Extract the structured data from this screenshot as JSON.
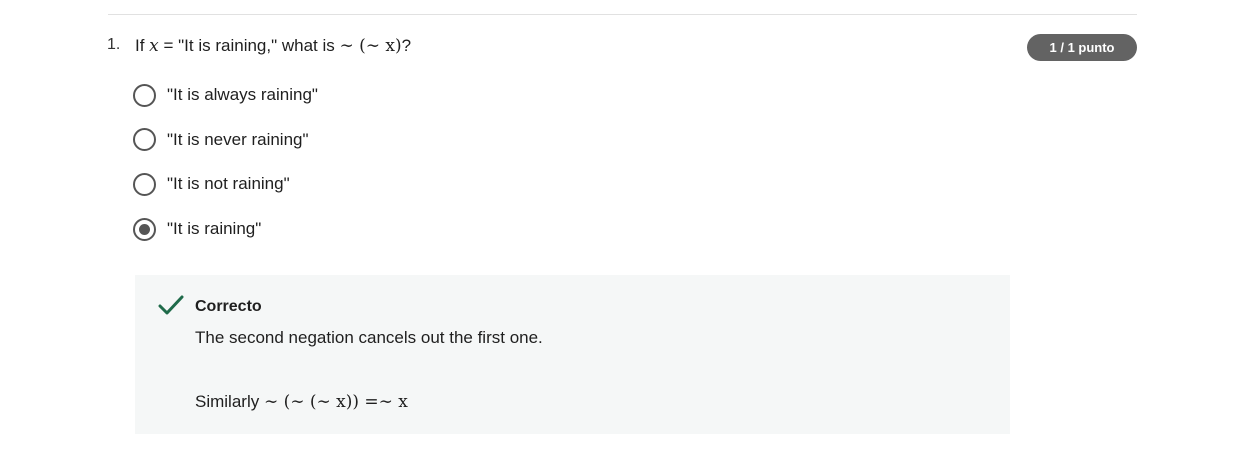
{
  "question": {
    "number": "1.",
    "text_prefix": "If ",
    "var_x": "x",
    "text_mid": " = \"It is raining,\" what is ",
    "math_expr": "∼ (∼ x)",
    "text_suffix": "?",
    "score": "1 / 1 punto"
  },
  "options": [
    {
      "label": "\"It is always raining\"",
      "selected": false
    },
    {
      "label": "\"It is never raining\"",
      "selected": false
    },
    {
      "label": "\"It is not raining\"",
      "selected": false
    },
    {
      "label": "\"It is raining\"",
      "selected": true
    }
  ],
  "feedback": {
    "icon": "checkmark-icon",
    "status": "Correcto",
    "explanation": "The second negation cancels out the first one.",
    "similarly_prefix": "Similarly ",
    "similarly_expr": "∼ (∼ (∼ x)) =∼ x",
    "accent_color": "#1f6b4a"
  }
}
